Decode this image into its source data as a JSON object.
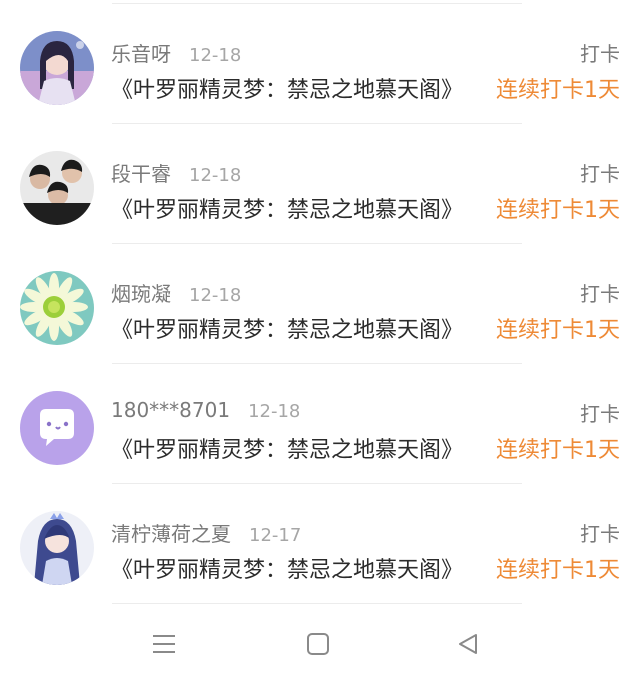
{
  "entries": [
    {
      "name": "乐音呀",
      "date": "12-18",
      "action": "打卡",
      "title": "《叶罗丽精灵梦：禁忌之地慕天阁》",
      "streak": "连续打卡1天",
      "avatar": "anime-girl-avatar"
    },
    {
      "name": "段干睿",
      "date": "12-18",
      "action": "打卡",
      "title": "《叶罗丽精灵梦：禁忌之地慕天阁》",
      "streak": "连续打卡1天",
      "avatar": "group-photo-avatar"
    },
    {
      "name": "烟琬凝",
      "date": "12-18",
      "action": "打卡",
      "title": "《叶罗丽精灵梦：禁忌之地慕天阁》",
      "streak": "连续打卡1天",
      "avatar": "flower-avatar"
    },
    {
      "name": "180***8701",
      "date": "12-18",
      "action": "打卡",
      "title": "《叶罗丽精灵梦：禁忌之地慕天阁》",
      "streak": "连续打卡1天",
      "avatar": "chat-bubble-avatar"
    },
    {
      "name": "清柠薄荷之夏",
      "date": "12-17",
      "action": "打卡",
      "title": "《叶罗丽精灵梦：禁忌之地慕天阁》",
      "streak": "连续打卡1天",
      "avatar": "anime-blue-hair-avatar"
    }
  ],
  "navbar": {
    "menu_icon": "menu-icon",
    "home_icon": "home-square-icon",
    "back_icon": "back-triangle-icon"
  },
  "colors": {
    "streak": "#ee8a36",
    "name": "#7a7a7a",
    "title": "#2b2b2b"
  }
}
